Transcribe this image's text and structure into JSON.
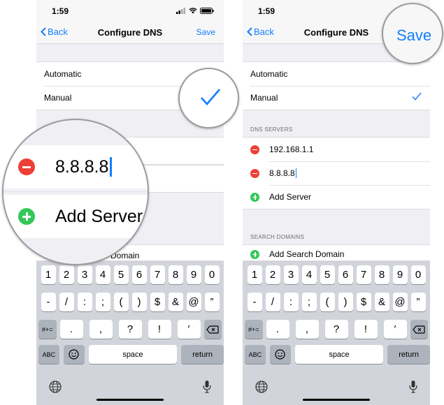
{
  "left_phone": {
    "status": {
      "time": "1:59"
    },
    "nav": {
      "back_label": "Back",
      "title": "Configure DNS",
      "save_label": "Save"
    },
    "mode": {
      "automatic": "Automatic",
      "manual": "Manual"
    },
    "partial_add_search_domain": "Domain",
    "magnifier": {
      "server_value": "8.8.8.8",
      "add_server_label": "Add Server"
    }
  },
  "right_phone": {
    "status": {
      "time": "1:59"
    },
    "nav": {
      "back_label": "Back",
      "title": "Configure DNS",
      "save_label": "Save"
    },
    "mode": {
      "automatic": "Automatic",
      "manual": "Manual"
    },
    "dns_header": "DNS SERVERS",
    "servers": [
      "192.168.1.1",
      "8.8.8.8"
    ],
    "add_server_label": "Add Server",
    "search_header": "SEARCH DOMAINS",
    "add_search_domain_label": "Add Search Domain"
  },
  "keyboard": {
    "row1": [
      "1",
      "2",
      "3",
      "4",
      "5",
      "6",
      "7",
      "8",
      "9",
      "0"
    ],
    "row2": [
      "-",
      "/",
      ":",
      ";",
      "(",
      ")",
      "$",
      "&",
      "@",
      "”"
    ],
    "row3_switch": "#+=",
    "row3": [
      ".",
      ",",
      "?",
      "!",
      "′"
    ],
    "abc": "ABC",
    "space": "space",
    "return": "return"
  },
  "colors": {
    "accent": "#147efb",
    "delete": "#ec3f35",
    "add": "#34c759",
    "background": "#efeff4"
  }
}
